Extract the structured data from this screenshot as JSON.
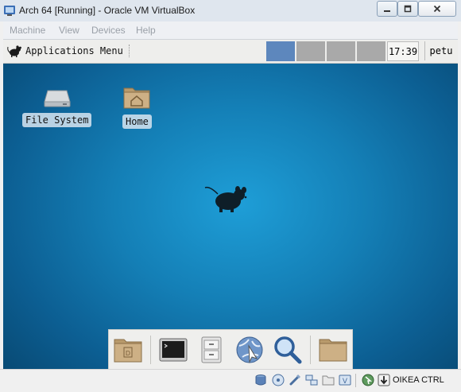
{
  "window": {
    "title": "Arch 64 [Running] - Oracle VM VirtualBox",
    "controls": [
      "minimize-icon",
      "maximize-icon",
      "close-icon"
    ]
  },
  "menubar": {
    "items": [
      "Machine",
      "View",
      "Devices",
      "Help"
    ]
  },
  "guest": {
    "panel": {
      "app_menu_label": "Applications Menu",
      "workspaces": [
        {
          "active": true
        },
        {
          "active": false
        },
        {
          "active": false
        },
        {
          "active": false
        }
      ],
      "clock": "17:39",
      "user": "petu"
    },
    "desktop": {
      "icons": [
        {
          "label": "File System",
          "icon": "drive-icon"
        },
        {
          "label": "Home",
          "icon": "home-folder-icon"
        }
      ]
    },
    "dock": {
      "items": [
        "file-manager-icon",
        "terminal-icon",
        "file-cabinet-icon",
        "web-browser-icon",
        "search-icon",
        "folder-icon"
      ]
    }
  },
  "statusbar": {
    "icons": [
      "hard-disk-icon",
      "optical-drive-icon",
      "usb-icon",
      "network-icon",
      "shared-folders-icon",
      "video-capture-icon",
      "mouse-integration-icon",
      "keyboard-capture-icon"
    ],
    "host_key": "OIKEA CTRL"
  },
  "colors": {
    "desktop_center": "#1e9ed7",
    "desktop_edge": "#084a74",
    "active_workspace": "#5d87bd",
    "inactive_workspace": "#a9a9a9"
  }
}
